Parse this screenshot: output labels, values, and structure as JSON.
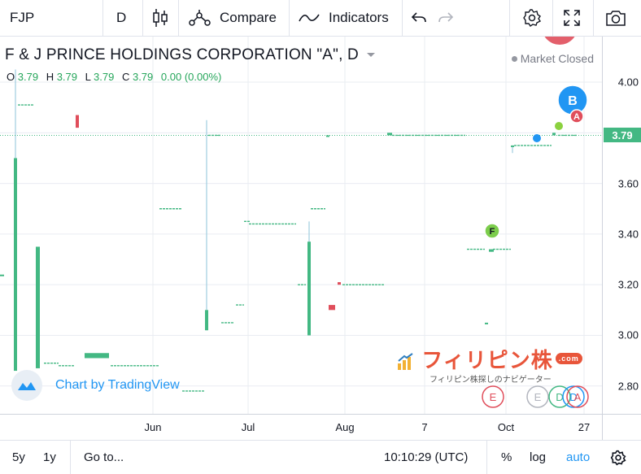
{
  "toolbar": {
    "symbol": "FJP",
    "interval": "D",
    "compare_label": "Compare",
    "indicators_label": "Indicators"
  },
  "legend": {
    "title": "F & J PRINCE HOLDINGS CORPORATION \"A\", D",
    "o_label": "O",
    "o_value": "3.79",
    "h_label": "H",
    "h_value": "3.79",
    "l_label": "L",
    "l_value": "3.79",
    "c_label": "C",
    "c_value": "3.79",
    "change": "0.00 (0.00%)",
    "market_status": "Market Closed"
  },
  "watermark": {
    "text": "Chart by TradingView",
    "filipin_text": "フィリピン株",
    "filipin_com": ".com",
    "filipin_sub": "フィリピン株探しのナビゲーター"
  },
  "bottombar": {
    "range_5y": "5y",
    "range_1y": "1y",
    "goto": "Go to...",
    "clock": "10:10:29 (UTC)",
    "percent": "%",
    "log": "log",
    "auto": "auto"
  },
  "colors": {
    "up": "#43b883",
    "down": "#e04e5b",
    "wick": "#9fcde0",
    "accent": "#2196f3",
    "pricegrid": "#e9ecf2"
  },
  "chart_data": {
    "type": "candlestick",
    "symbol": "FJP",
    "interval": "D",
    "last_price": 3.79,
    "y_ticks": [
      4.0,
      3.8,
      3.6,
      3.4,
      3.2,
      3.0,
      2.8
    ],
    "y_tick_labels": [
      "4.00",
      "3.80",
      "3.60",
      "3.40",
      "3.20",
      "3.00",
      "2.80"
    ],
    "ylim": [
      2.69,
      4.18
    ],
    "x_tick_labels": [
      "Jun",
      "Jul",
      "Aug",
      "7",
      "Oct",
      "27"
    ],
    "segments": [
      {
        "o": 3.24,
        "c": 3.24,
        "h": 3.24,
        "l": 3.24
      },
      {
        "o": 2.86,
        "c": 3.7,
        "h": 4.05,
        "l": 2.86
      },
      {
        "o": 3.91,
        "c": 3.91,
        "h": 3.91,
        "l": 3.91
      },
      {
        "o": 2.87,
        "c": 3.35,
        "h": 3.35,
        "l": 2.87
      },
      {
        "o": 2.89,
        "c": 2.89,
        "h": 2.89,
        "l": 2.89
      },
      {
        "o": 2.88,
        "c": 2.88,
        "h": 2.88,
        "l": 2.88
      },
      {
        "o": 2.91,
        "c": 2.93,
        "h": 2.93,
        "l": 2.91
      },
      {
        "o": 3.87,
        "c": 3.82,
        "h": 3.87,
        "l": 3.82
      },
      {
        "o": 2.88,
        "c": 2.88,
        "h": 2.88,
        "l": 2.88
      },
      {
        "o": 3.5,
        "c": 3.5,
        "h": 3.5,
        "l": 3.5
      },
      {
        "o": 2.78,
        "c": 2.78,
        "h": 2.78,
        "l": 2.78
      },
      {
        "o": 3.02,
        "c": 3.1,
        "h": 3.85,
        "l": 3.02
      },
      {
        "o": 3.79,
        "c": 3.79,
        "h": 3.79,
        "l": 3.79
      },
      {
        "o": 3.05,
        "c": 3.05,
        "h": 3.05,
        "l": 3.05
      },
      {
        "o": 3.12,
        "c": 3.12,
        "h": 3.12,
        "l": 3.12
      },
      {
        "o": 3.45,
        "c": 3.45,
        "h": 3.45,
        "l": 3.45
      },
      {
        "o": 3.44,
        "c": 3.44,
        "h": 3.44,
        "l": 3.44
      },
      {
        "o": 3.2,
        "c": 3.2,
        "h": 3.2,
        "l": 3.2
      },
      {
        "o": 3.0,
        "c": 3.37,
        "h": 3.45,
        "l": 3.0
      },
      {
        "o": 3.5,
        "c": 3.5,
        "h": 3.5,
        "l": 3.5
      },
      {
        "o": 3.79,
        "c": 3.79,
        "h": 3.79,
        "l": 3.79
      },
      {
        "o": 3.12,
        "c": 3.1,
        "h": 3.12,
        "l": 3.1
      },
      {
        "o": 3.21,
        "c": 3.2,
        "h": 3.21,
        "l": 3.2
      },
      {
        "o": 3.2,
        "c": 3.2,
        "h": 3.2,
        "l": 3.2
      },
      {
        "o": 3.79,
        "c": 3.8,
        "h": 3.8,
        "l": 3.79
      },
      {
        "o": 3.79,
        "c": 3.79,
        "h": 3.79,
        "l": 3.79
      },
      {
        "o": 3.34,
        "c": 3.34,
        "h": 3.34,
        "l": 3.34
      },
      {
        "o": 3.05,
        "c": 3.05,
        "h": 3.05,
        "l": 3.05
      },
      {
        "o": 3.33,
        "c": 3.34,
        "h": 3.34,
        "l": 3.33
      },
      {
        "o": 3.34,
        "c": 3.34,
        "h": 3.34,
        "l": 3.34
      },
      {
        "o": 3.75,
        "c": 3.75,
        "h": 3.75,
        "l": 3.72
      },
      {
        "o": 3.75,
        "c": 3.75,
        "h": 3.75,
        "l": 3.75
      },
      {
        "o": 3.79,
        "c": 3.8,
        "h": 3.8,
        "l": 3.79
      },
      {
        "o": 3.79,
        "c": 3.79,
        "h": 3.79,
        "l": 3.79
      }
    ],
    "event_markers": [
      {
        "letter": "B",
        "y": 3.92,
        "color": "#2196f3",
        "big": true
      },
      {
        "letter": "A",
        "y": 3.86,
        "color": "#e04e5b",
        "big": false
      },
      {
        "letter": "F",
        "y": 3.41,
        "color": "#7ccd4c",
        "big": false
      }
    ],
    "dots": [
      {
        "y": 3.77,
        "color": "#2196f3"
      },
      {
        "y": 3.82,
        "color": "#8bd13f"
      }
    ],
    "bottom_markers": [
      "E",
      "E",
      "D",
      "D",
      "A"
    ]
  }
}
